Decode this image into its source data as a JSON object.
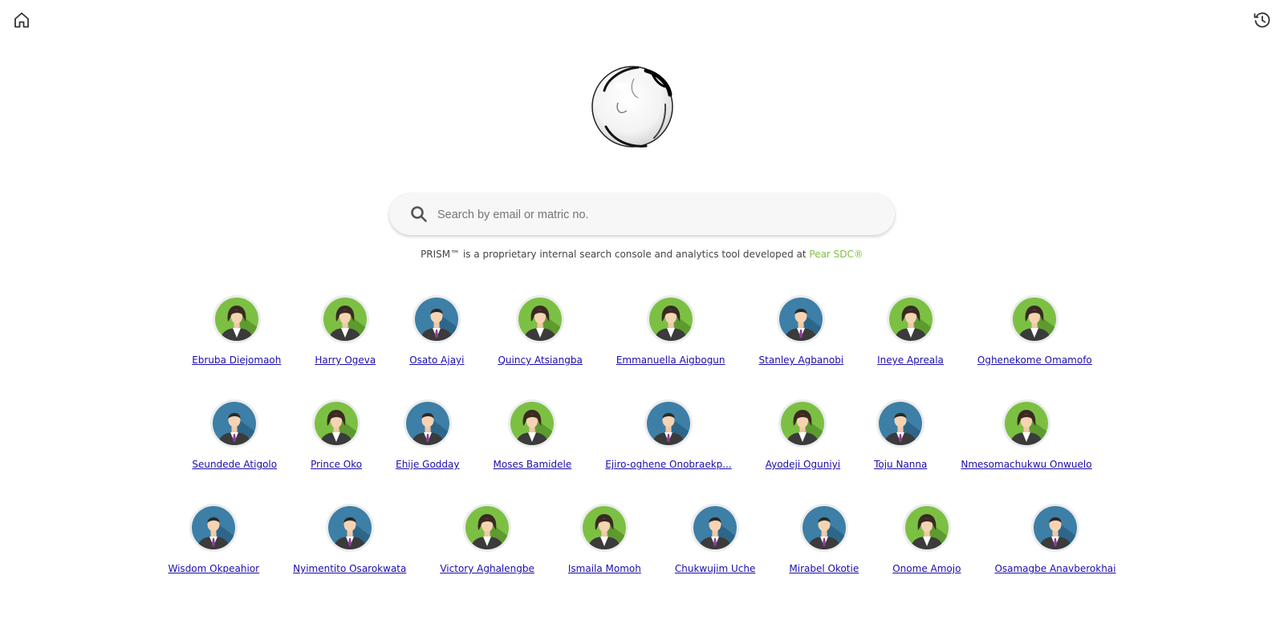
{
  "nav": {
    "home_icon": "home-icon",
    "history_icon": "history-icon"
  },
  "logo": {
    "name": "glass-sphere-logo"
  },
  "search": {
    "placeholder": "Search by email or matric no.",
    "icon": "search-icon"
  },
  "tagline": {
    "text": "PRISM™ is a proprietary internal search console and analytics tool developed at ",
    "brand": "Pear SDC®",
    "brand_color": "#7cc043"
  },
  "colors": {
    "female_avatar_bg": "#7cc043",
    "male_avatar_bg": "#3d7fa6",
    "link": "#1a0dab"
  },
  "people": [
    [
      {
        "name": "Ebruba Diejomaoh",
        "avatar": "female"
      },
      {
        "name": "Harry Ogeva",
        "avatar": "female"
      },
      {
        "name": "Osato Ajayi",
        "avatar": "male"
      },
      {
        "name": "Quincy Atsiangba",
        "avatar": "female"
      },
      {
        "name": "Emmanuella Aigbogun",
        "avatar": "female"
      },
      {
        "name": "Stanley Agbanobi",
        "avatar": "male"
      },
      {
        "name": "Ineye Apreala",
        "avatar": "female"
      },
      {
        "name": "Oghenekome Omamofo",
        "avatar": "female"
      }
    ],
    [
      {
        "name": "Seundede Atigolo",
        "avatar": "male"
      },
      {
        "name": "Prince Oko",
        "avatar": "female"
      },
      {
        "name": "Ehije Godday",
        "avatar": "male"
      },
      {
        "name": "Moses Bamidele",
        "avatar": "female"
      },
      {
        "name": "Ejiro-oghene Onobraekp...",
        "avatar": "male"
      },
      {
        "name": "Ayodeji Oguniyi",
        "avatar": "female"
      },
      {
        "name": "Toju Nanna",
        "avatar": "male"
      },
      {
        "name": "Nmesomachukwu Onwuelo",
        "avatar": "female"
      }
    ],
    [
      {
        "name": "Wisdom Okpeahior",
        "avatar": "male"
      },
      {
        "name": "Nyimentito Osarokwata",
        "avatar": "male"
      },
      {
        "name": "Victory Aghalengbe",
        "avatar": "female"
      },
      {
        "name": "Ismaila Momoh",
        "avatar": "female"
      },
      {
        "name": "Chukwujim Uche",
        "avatar": "male"
      },
      {
        "name": "Mirabel Okotie",
        "avatar": "male"
      },
      {
        "name": "Onome Amojo",
        "avatar": "female"
      },
      {
        "name": "Osamagbe Anavberokhai",
        "avatar": "male"
      }
    ]
  ]
}
